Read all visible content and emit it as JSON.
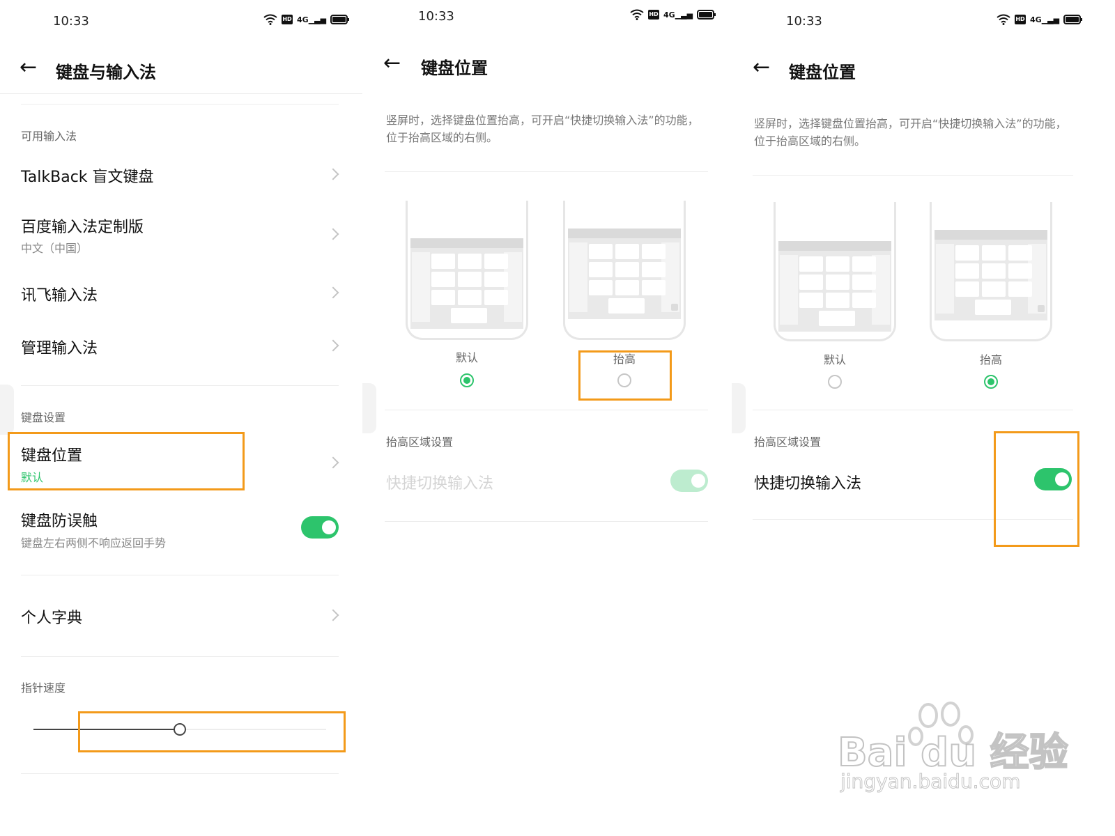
{
  "status_bar": {
    "time": "10:33",
    "hd": "HD",
    "signal": "4G"
  },
  "panel1": {
    "title": "键盘与输入法",
    "section_available": "可用输入法",
    "items": [
      {
        "title": "TalkBack 盲文键盘"
      },
      {
        "title": "百度输入法定制版",
        "subtitle": "中文（中国）"
      },
      {
        "title": "讯飞输入法"
      },
      {
        "title": "管理输入法"
      }
    ],
    "section_keyboard": "键盘设置",
    "keyboard_position": {
      "title": "键盘位置",
      "value": "默认"
    },
    "mistouch": {
      "title": "键盘防误触",
      "subtitle": "键盘左右两侧不响应返回手势",
      "enabled": true
    },
    "dictionary": {
      "title": "个人字典"
    },
    "section_pointer": "指针速度",
    "pointer_speed": 0.5
  },
  "panel2": {
    "title": "键盘位置",
    "description": "竖屏时，选择键盘位置抬高，可开启“快捷切换输入法”的功能，位于抬高区域的右侧。",
    "options": [
      {
        "label": "默认",
        "selected": true
      },
      {
        "label": "抬高",
        "selected": false
      }
    ],
    "section": "抬高区域设置",
    "quick_switch": {
      "title": "快捷切换输入法",
      "enabled": true,
      "disabled_state": true
    }
  },
  "panel3": {
    "title": "键盘位置",
    "description": "竖屏时，选择键盘位置抬高，可开启“快捷切换输入法”的功能，位于抬高区域的右侧。",
    "options": [
      {
        "label": "默认",
        "selected": false
      },
      {
        "label": "抬高",
        "selected": true
      }
    ],
    "section": "抬高区域设置",
    "quick_switch": {
      "title": "快捷切换输入法",
      "enabled": true
    }
  },
  "watermark": {
    "brand": "Bai du 经验",
    "url": "jingyan.baidu.com"
  },
  "colors": {
    "accent_green": "#2dc46c",
    "highlight_orange": "#f39a1a"
  }
}
